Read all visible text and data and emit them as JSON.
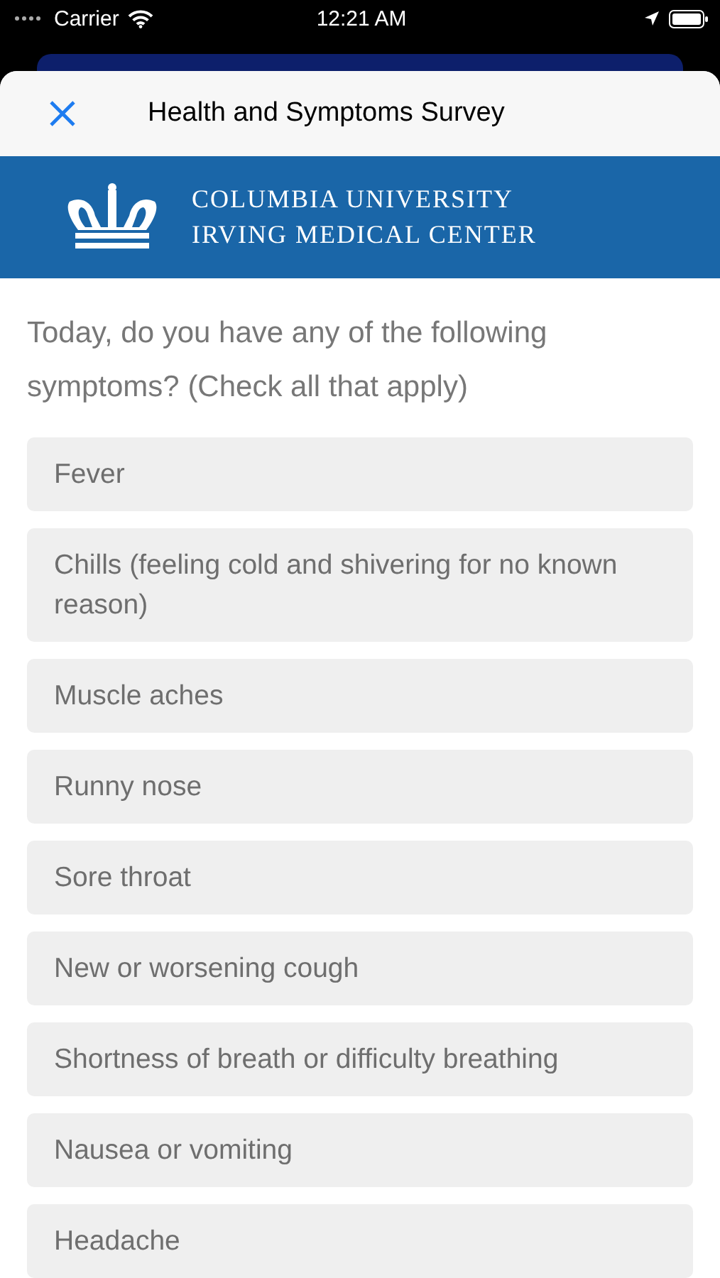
{
  "status_bar": {
    "carrier": "Carrier",
    "time": "12:21 AM"
  },
  "header": {
    "title": "Health and Symptoms Survey"
  },
  "banner": {
    "line_1": "COLUMBIA UNIVERSITY",
    "line_2": "IRVING MEDICAL CENTER"
  },
  "question": "Today, do you have any of the following symptoms? (Check all that apply)",
  "options": [
    {
      "label": "Fever",
      "selected": false
    },
    {
      "label": "Chills (feeling cold and shivering for no known reason)",
      "selected": false
    },
    {
      "label": "Muscle aches",
      "selected": false
    },
    {
      "label": "Runny nose",
      "selected": false
    },
    {
      "label": "Sore throat",
      "selected": false
    },
    {
      "label": "New or worsening cough",
      "selected": false
    },
    {
      "label": "Shortness of breath or difficulty breathing",
      "selected": false
    },
    {
      "label": "Nausea or vomiting",
      "selected": false
    },
    {
      "label": "Headache",
      "selected": false
    }
  ]
}
